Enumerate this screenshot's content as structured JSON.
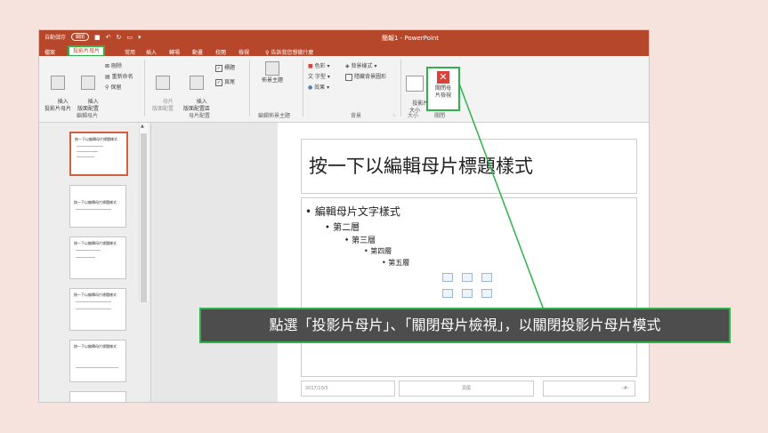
{
  "window": {
    "autosave_label": "自動儲存",
    "autosave_state": "關閉",
    "title": "簡報1 - PowerPoint"
  },
  "tabs": [
    {
      "label": "檔案"
    },
    {
      "label": "投影片母片",
      "active": true
    },
    {
      "label": "常用"
    },
    {
      "label": "插入"
    },
    {
      "label": "轉場"
    },
    {
      "label": "動畫"
    },
    {
      "label": "校閱"
    },
    {
      "label": "檢視"
    }
  ],
  "tell_me": "告訴我您想做什麼",
  "ribbon": {
    "insert_slide_master": "插入\n投影片母片",
    "insert_layout": "插入\n版面配置",
    "delete": "刪除",
    "rename": "重新命名",
    "preserve": "保留",
    "group_edit_master": "編輯母片",
    "master_layout": "母片\n版面配置",
    "insert_placeholder": "插入\n版面配置區",
    "title_check": "標題",
    "footer_check": "頁尾",
    "group_master_layout": "母片配置",
    "themes": "佈景主題",
    "group_edit_theme": "編輯佈景主題",
    "colors": "色彩",
    "fonts": "字型",
    "effects": "效果",
    "background_styles": "背景樣式",
    "hide_background": "隱藏背景圖形",
    "group_background": "背景",
    "slide_size": "投影片\n大小",
    "group_size": "大小",
    "close_master_view": "關閉母\n片檢視",
    "group_close": "關閉"
  },
  "thumbnails": [
    {
      "title": "按一下以編輯母片標題樣式",
      "selected": true
    },
    {
      "title": "按一下以編輯母片標題樣式",
      "selected": false
    },
    {
      "title": "按一下以編輯母片標題樣式",
      "selected": false
    },
    {
      "title": "按一下以編輯母片標題樣式",
      "selected": false
    },
    {
      "title": "按一下以編輯母片標題樣式",
      "selected": false
    }
  ],
  "slide": {
    "title": "按一下以編輯母片標題樣式",
    "levels": [
      "編輯母片文字樣式",
      "第二層",
      "第三層",
      "第四層",
      "第五層"
    ],
    "footer_date": "2017/10/5",
    "footer_text": "頁尾",
    "footer_num": "‹#›"
  },
  "callout": "點選「投影片母片」、「關閉母片檢視」，以關閉投影片母片模式",
  "colors": {
    "accent": "#b7472a",
    "highlight": "#2db34a",
    "callout_bg": "#4d4d4d",
    "background": "#f7e3dd"
  }
}
